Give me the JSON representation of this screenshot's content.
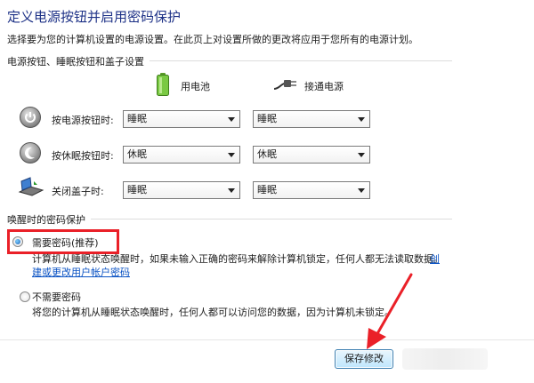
{
  "header": {
    "title": "定义电源按钮并启用密码保护",
    "description": "选择要为您的计算机设置的电源设置。在此页上对设置所做的更改将应用于您所有的电源计划。"
  },
  "power_section": {
    "title": "电源按钮、睡眠按钮和盖子设置",
    "col_battery": "用电池",
    "col_plugged": "接通电源",
    "rows": [
      {
        "label": "按电源按钮时:",
        "battery": "睡眠",
        "plugged": "睡眠",
        "icon": "power-icon"
      },
      {
        "label": "按休眠按钮时:",
        "battery": "休眠",
        "plugged": "休眠",
        "icon": "sleep-icon"
      },
      {
        "label": "关闭盖子时:",
        "battery": "睡眠",
        "plugged": "睡眠",
        "icon": "laptop-lid-icon"
      }
    ]
  },
  "password_section": {
    "title": "唤醒时的密码保护",
    "require": {
      "label": "需要密码(推荐)",
      "desc_line1": "计算机从睡眠状态唤醒时，如果未输入正确的密码来解除计算机锁定，任何人都无法读取数据。",
      "link_part1": "创",
      "link_part2": "建或更改用户帐户密码",
      "selected": true
    },
    "no_require": {
      "label": "不需要密码",
      "desc": "将您的计算机从睡眠状态唤醒时，任何人都可以访问您的数据，因为计算机未锁定。",
      "selected": false
    }
  },
  "footer": {
    "save_label": "保存修改"
  },
  "colors": {
    "title": "#1e3287",
    "link": "#0b53c4",
    "highlight": "#ea2028",
    "arrow": "#ea2028"
  }
}
